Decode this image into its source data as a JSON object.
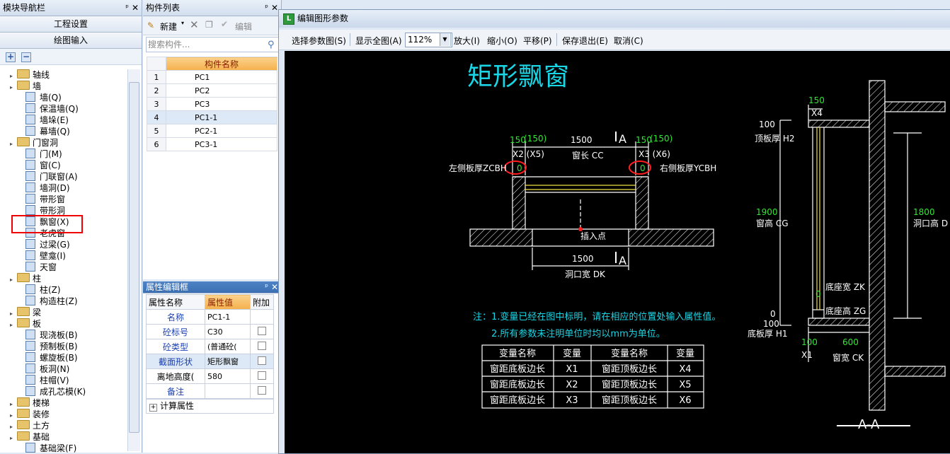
{
  "nav": {
    "title": "模块导航栏",
    "btn_project": "工程设置",
    "btn_draw": "绘图输入",
    "tree": [
      {
        "label": "轴线",
        "type": "folder",
        "level": 0
      },
      {
        "label": "墙",
        "type": "folder",
        "level": 0
      },
      {
        "label": "墙(Q)",
        "type": "item",
        "level": 1
      },
      {
        "label": "保温墙(Q)",
        "type": "item",
        "level": 1
      },
      {
        "label": "墙垛(E)",
        "type": "item",
        "level": 1
      },
      {
        "label": "幕墙(Q)",
        "type": "item",
        "level": 1
      },
      {
        "label": "门窗洞",
        "type": "folder",
        "level": 0
      },
      {
        "label": "门(M)",
        "type": "item",
        "level": 1
      },
      {
        "label": "窗(C)",
        "type": "item",
        "level": 1
      },
      {
        "label": "门联窗(A)",
        "type": "item",
        "level": 1
      },
      {
        "label": "墙洞(D)",
        "type": "item",
        "level": 1
      },
      {
        "label": "带形窗",
        "type": "item",
        "level": 1
      },
      {
        "label": "带形洞",
        "type": "item",
        "level": 1
      },
      {
        "label": "飘窗(X)",
        "type": "item",
        "level": 1
      },
      {
        "label": "老虎窗",
        "type": "item",
        "level": 1
      },
      {
        "label": "过梁(G)",
        "type": "item",
        "level": 1
      },
      {
        "label": "壁龛(I)",
        "type": "item",
        "level": 1
      },
      {
        "label": "天窗",
        "type": "item",
        "level": 1
      },
      {
        "label": "柱",
        "type": "folder",
        "level": 0
      },
      {
        "label": "柱(Z)",
        "type": "item",
        "level": 1
      },
      {
        "label": "构造柱(Z)",
        "type": "item",
        "level": 1
      },
      {
        "label": "梁",
        "type": "folder",
        "level": 0
      },
      {
        "label": "板",
        "type": "folder",
        "level": 0
      },
      {
        "label": "现浇板(B)",
        "type": "item",
        "level": 1
      },
      {
        "label": "预制板(B)",
        "type": "item",
        "level": 1
      },
      {
        "label": "螺旋板(B)",
        "type": "item",
        "level": 1
      },
      {
        "label": "板洞(N)",
        "type": "item",
        "level": 1
      },
      {
        "label": "柱帽(V)",
        "type": "item",
        "level": 1
      },
      {
        "label": "成孔芯模(K)",
        "type": "item",
        "level": 1
      },
      {
        "label": "楼梯",
        "type": "folder",
        "level": 0
      },
      {
        "label": "装修",
        "type": "folder",
        "level": 0
      },
      {
        "label": "土方",
        "type": "folder",
        "level": 0
      },
      {
        "label": "基础",
        "type": "folder",
        "level": 0
      },
      {
        "label": "基础梁(F)",
        "type": "item",
        "level": 1
      }
    ]
  },
  "components": {
    "title": "构件列表",
    "new_label": "新建",
    "edit_label": "编辑",
    "search_placeholder": "搜索构件...",
    "col_name": "构件名称",
    "rows": [
      {
        "n": "1",
        "name": "PC1"
      },
      {
        "n": "2",
        "name": "PC2"
      },
      {
        "n": "3",
        "name": "PC3"
      },
      {
        "n": "4",
        "name": "PC1-1"
      },
      {
        "n": "5",
        "name": "PC2-1"
      },
      {
        "n": "6",
        "name": "PC3-1"
      }
    ]
  },
  "props": {
    "title": "属性编辑框",
    "col_name": "属性名称",
    "col_value": "属性值",
    "col_extra": "附加",
    "rows": [
      {
        "name": "名称",
        "value": "PC1-1"
      },
      {
        "name": "砼标号",
        "value": "C30"
      },
      {
        "name": "砼类型",
        "value": "(普通砼("
      },
      {
        "name": "截面形状",
        "value": "矩形飘窗"
      },
      {
        "name": "离地高度(",
        "value": "580"
      },
      {
        "name": "备注",
        "value": ""
      }
    ],
    "calc_label": "计算属性"
  },
  "dialog": {
    "title": "编辑图形参数",
    "menu": [
      "选择参数图(S)",
      "显示全图(A)",
      "放大(I)",
      "缩小(O)",
      "平移(P)",
      "保存退出(E)",
      "取消(C)"
    ],
    "zoom": "112%"
  },
  "drawing": {
    "title": "矩形飘窗",
    "section_mark": "A",
    "labels": {
      "v150a": "150",
      "v150b": "(150)",
      "v1500": "1500",
      "v150c": "150",
      "v150d": "(150)",
      "x2x5": "X2 (X5)",
      "window_len": "窗长 CC",
      "x3x6": "X3 (X6)",
      "left_thick": "左侧板厚ZCBH",
      "right_thick": "右侧板厚YCBH",
      "zero": "0",
      "insert": "插入点",
      "v1500b": "1500",
      "opening_w": "洞口宽 DK",
      "v150e": "150",
      "x4": "X4",
      "v100a": "100",
      "top_thick": "顶板厚 H2",
      "v1900": "1900",
      "win_h": "窗高 CG",
      "v1800": "1800",
      "open_h": "洞口高 D",
      "seat_w": "底座宽 ZK",
      "seat_h": "底座高 ZG",
      "v0a": "0",
      "v0b": "0",
      "v100b": "100",
      "bot_thick": "底板厚 H1",
      "v100c": "100",
      "v600": "600",
      "x1": "X1",
      "win_w": "窗宽 CK",
      "aa": "A-A"
    },
    "note1": "注：1.变量已经在图中标明，请在相应的位置处输入属性值。",
    "note2": "2.所有参数未注明单位时均以mm为单位。",
    "table_headers": [
      "变量名称",
      "变量",
      "变量名称",
      "变量"
    ],
    "table_rows": [
      [
        "窗距底板边长",
        "X1",
        "窗距顶板边长",
        "X4"
      ],
      [
        "窗距底板边长",
        "X2",
        "窗距顶板边长",
        "X5"
      ],
      [
        "窗距底板边长",
        "X3",
        "窗距顶板边长",
        "X6"
      ]
    ]
  },
  "colors": {
    "cyan": "#19d6e6",
    "green": "#32e632",
    "yellow": "#f0e040",
    "red": "#ff1e1e"
  }
}
